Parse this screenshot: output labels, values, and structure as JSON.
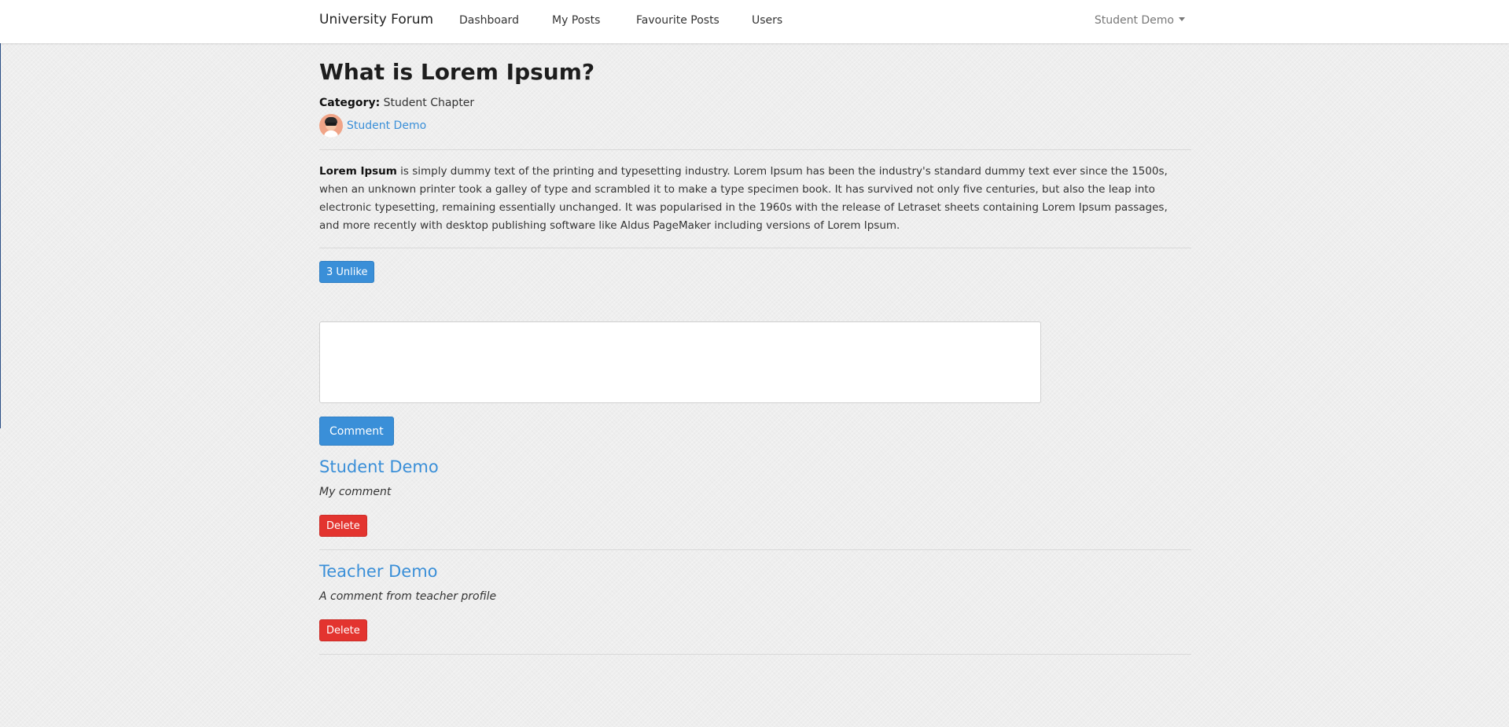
{
  "navbar": {
    "brand": "University Forum",
    "links": [
      "Dashboard",
      "My Posts",
      "Favourite Posts",
      "Users"
    ],
    "user": "Student Demo"
  },
  "post": {
    "title": "What is Lorem Ipsum?",
    "category_label": "Category:",
    "category": "Student Chapter",
    "author": "Student Demo",
    "body_bold": "Lorem Ipsum",
    "body_rest": " is simply dummy text of the printing and typesetting industry. Lorem Ipsum has been the industry's standard dummy text ever since the 1500s, when an unknown printer took a galley of type and scrambled it to make a type specimen book. It has survived not only five centuries, but also the leap into electronic typesetting, remaining essentially unchanged. It was popularised in the 1960s with the release of Letraset sheets containing Lorem Ipsum passages, and more recently with desktop publishing software like Aldus PageMaker including versions of Lorem Ipsum.",
    "like_button": "3 Unlike"
  },
  "comment_form": {
    "value": "",
    "submit_label": "Comment"
  },
  "comments": [
    {
      "author": "Student Demo",
      "text": "My comment",
      "delete_label": "Delete"
    },
    {
      "author": "Teacher Demo",
      "text": "A comment from teacher profile",
      "delete_label": "Delete"
    }
  ],
  "colors": {
    "accent": "#3a8fd8",
    "danger": "#e3342f"
  }
}
